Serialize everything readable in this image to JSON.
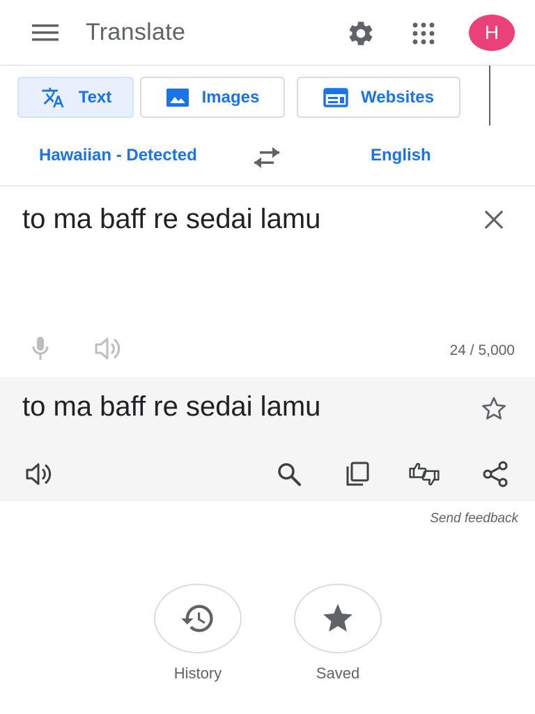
{
  "header": {
    "title": "Translate",
    "avatar_letter": "H",
    "avatar_color": "#ec407a",
    "icons": [
      "menu-icon",
      "gear-icon",
      "apps-grid-icon"
    ]
  },
  "modes": {
    "text": "Text",
    "images": "Images",
    "websites": "Websites",
    "active": "text"
  },
  "languages": {
    "source": "Hawaiian - Detected",
    "target": "English"
  },
  "source": {
    "value": "to ma baff re sedai lamu",
    "char_count": "24 / 5,000"
  },
  "result": {
    "text": "to ma baff re sedai lamu"
  },
  "feedback": "Send feedback",
  "bottom": {
    "history": "History",
    "saved": "Saved"
  },
  "colors": {
    "accent": "#1a73e8",
    "icon_gray": "#5f6368",
    "result_bg": "#f5f5f5"
  }
}
